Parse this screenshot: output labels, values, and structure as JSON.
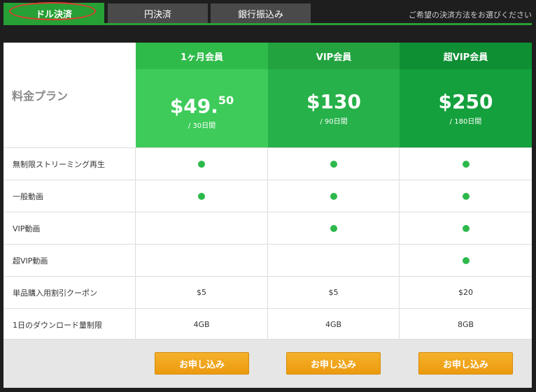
{
  "tabs": {
    "dollar": "ドル決済",
    "yen": "円決済",
    "bank": "銀行振込み",
    "instruction": "ご希望の決済方法をお選びください"
  },
  "table": {
    "plan_label": "料金プラン",
    "plans": [
      {
        "name": "1ヶ月会員",
        "price": "$49.",
        "price_cents": "50",
        "period": "/ 30日間",
        "color": "#3ecb5a",
        "head_color": "#2fbb4a"
      },
      {
        "name": "VIP会員",
        "price": "$130",
        "price_cents": "",
        "period": "/ 90日間",
        "color": "#27b14a",
        "head_color": "#22a33f"
      },
      {
        "name": "超VIP会員",
        "price": "$250",
        "price_cents": "",
        "period": "/ 180日間",
        "color": "#14a03c",
        "head_color": "#0e8f33"
      }
    ],
    "features": [
      {
        "label": "無制限ストリーミング再生",
        "values": [
          "dot",
          "dot",
          "dot"
        ]
      },
      {
        "label": "一般動画",
        "values": [
          "dot",
          "dot",
          "dot"
        ]
      },
      {
        "label": "VIP動画",
        "values": [
          "",
          "dot",
          "dot"
        ]
      },
      {
        "label": "超VIP動画",
        "values": [
          "",
          "",
          "dot"
        ]
      },
      {
        "label": "単品購入用割引クーポン",
        "values": [
          "$5",
          "$5",
          "$20"
        ]
      },
      {
        "label": "1日のダウンロード量制限",
        "values": [
          "4GB",
          "4GB",
          "8GB"
        ]
      }
    ],
    "apply_label": "お申し込み"
  },
  "colors": {
    "accent_green": "#27a035",
    "dot_green": "#2db84b",
    "button_orange": "#f0a41c",
    "highlight_red": "#e03a2e"
  }
}
